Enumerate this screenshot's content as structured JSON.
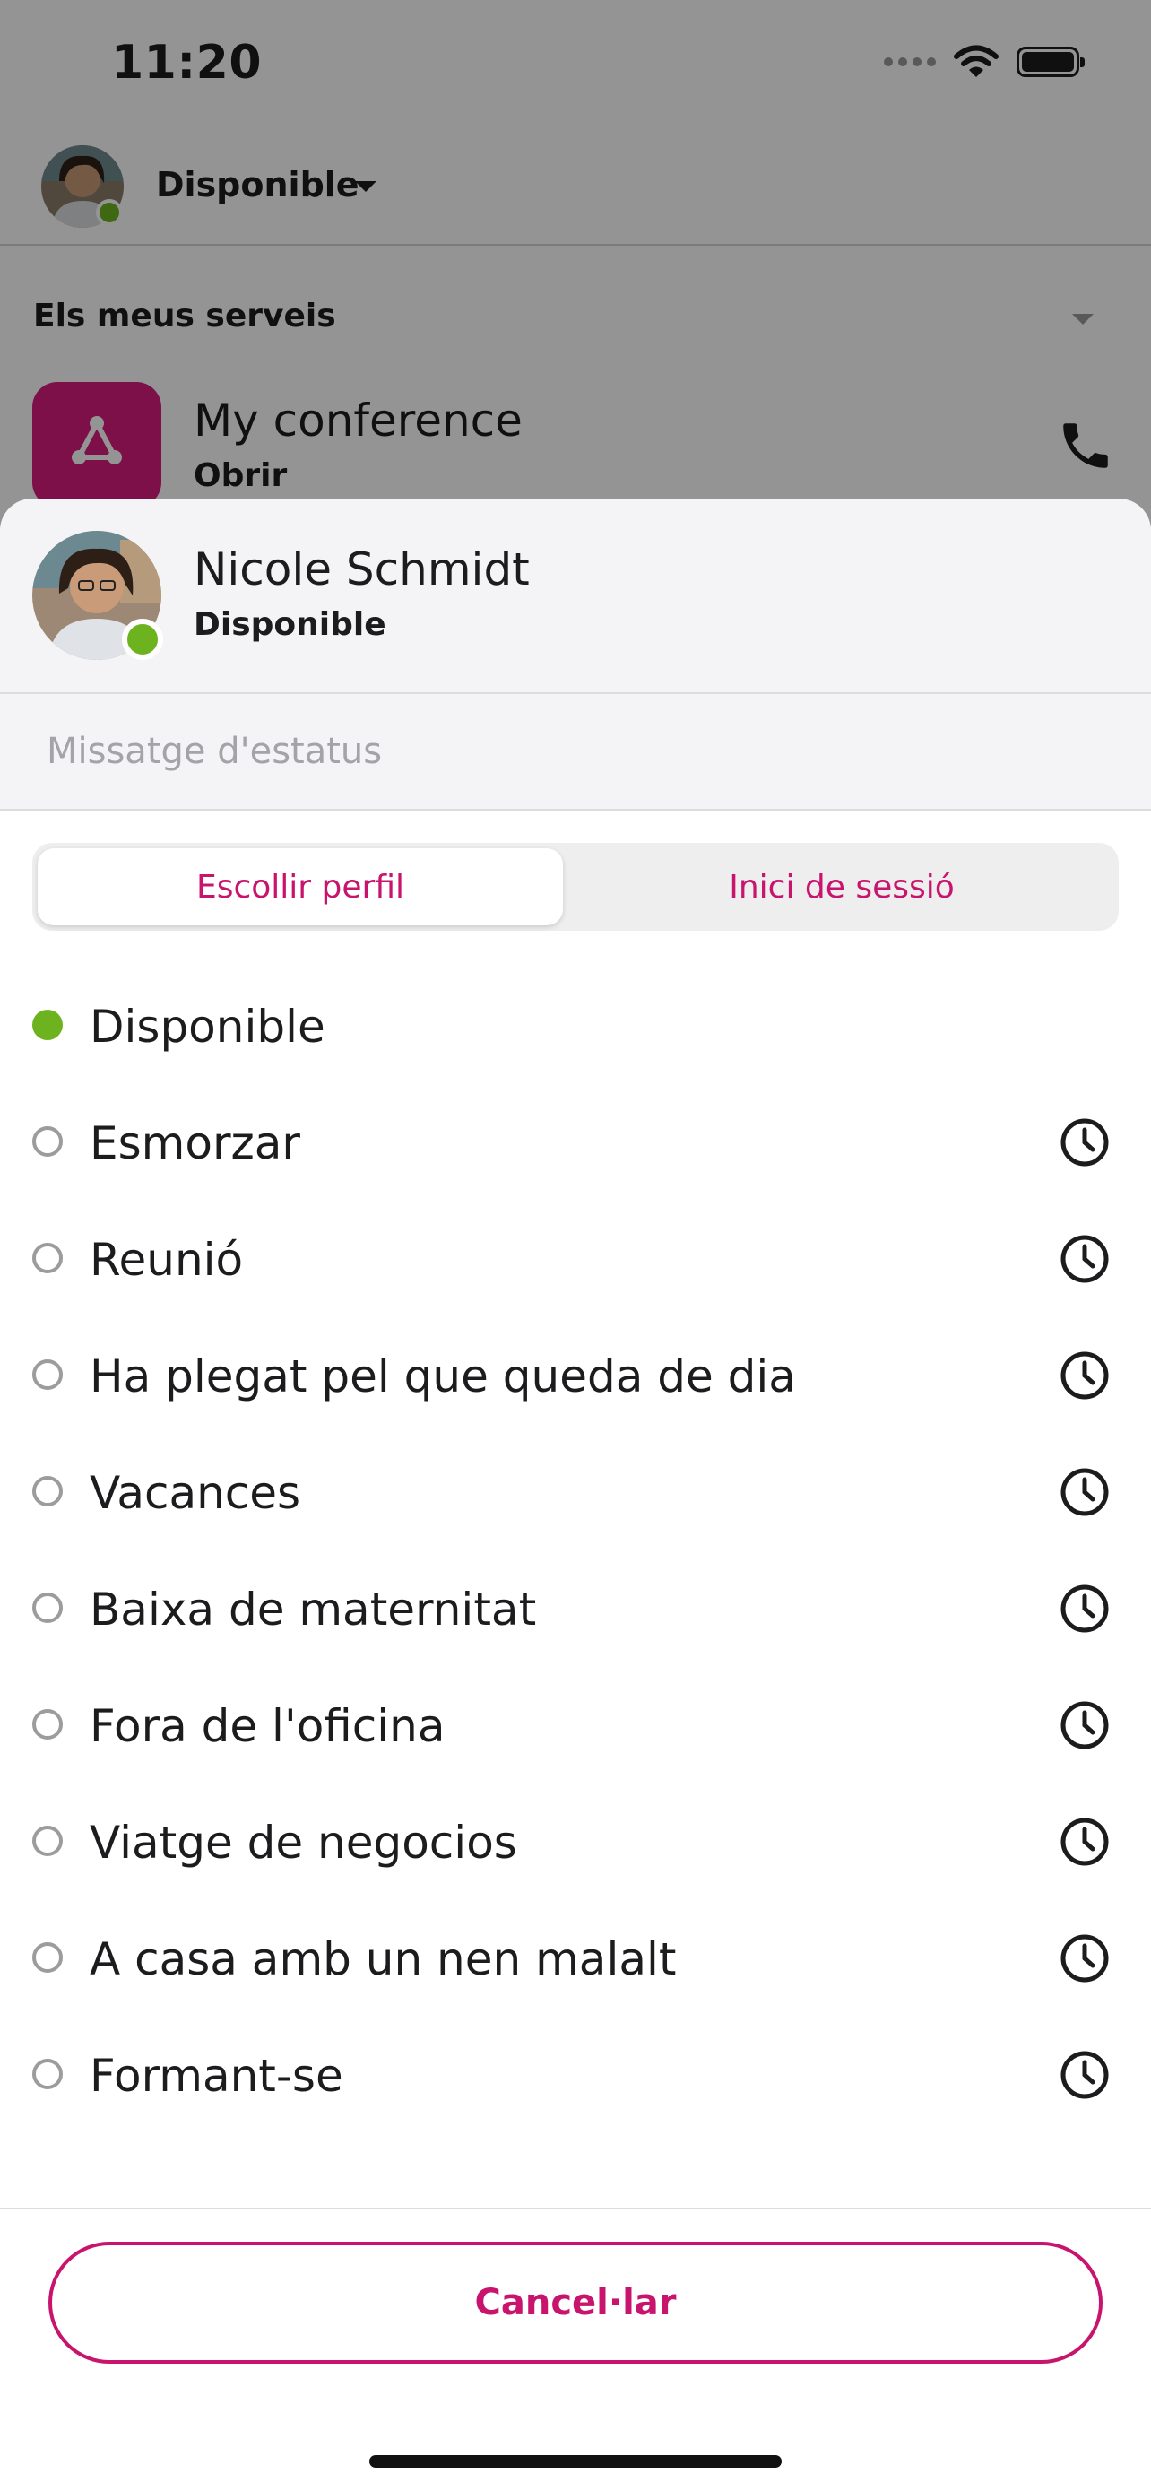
{
  "status_bar": {
    "time": "11:20"
  },
  "top_bar": {
    "status": "Disponible"
  },
  "services": {
    "title": "Els meus serveis",
    "item": {
      "name": "My conference",
      "action": "Obrir"
    }
  },
  "sheet": {
    "user": {
      "name": "Nicole Schmidt",
      "status": "Disponible"
    },
    "status_message_placeholder": "Missatge d'estatus",
    "tabs": [
      {
        "label": "Escollir perfil",
        "active": true
      },
      {
        "label": "Inici de sessió",
        "active": false
      }
    ],
    "statuses": [
      {
        "label": "Disponible",
        "selected": true,
        "has_timer": false
      },
      {
        "label": "Esmorzar",
        "selected": false,
        "has_timer": true
      },
      {
        "label": "Reunió",
        "selected": false,
        "has_timer": true
      },
      {
        "label": "Ha plegat pel que queda de dia",
        "selected": false,
        "has_timer": true
      },
      {
        "label": "Vacances",
        "selected": false,
        "has_timer": true
      },
      {
        "label": "Baixa de maternitat",
        "selected": false,
        "has_timer": true
      },
      {
        "label": "Fora de l'oficina",
        "selected": false,
        "has_timer": true
      },
      {
        "label": "Viatge de negocios",
        "selected": false,
        "has_timer": true
      },
      {
        "label": "A casa amb un nen malalt",
        "selected": false,
        "has_timer": true
      },
      {
        "label": "Formant-se",
        "selected": false,
        "has_timer": true
      }
    ],
    "cancel_label": "Cancel·lar"
  },
  "colors": {
    "accent": "#c8146d",
    "presence": "#6db31f",
    "conference_tile": "#d81b7e"
  },
  "icons": [
    "wifi-icon",
    "battery-icon",
    "signal-icon",
    "phone-icon",
    "conference-icon",
    "clock-icon"
  ]
}
